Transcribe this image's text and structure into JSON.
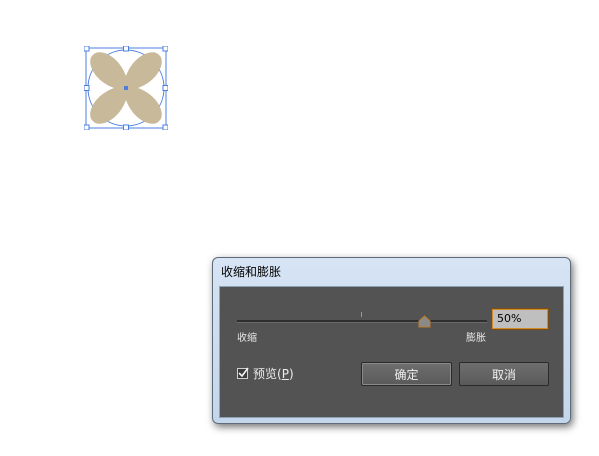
{
  "dialog": {
    "title": "收缩和膨胀",
    "slider": {
      "left_label": "收缩",
      "right_label": "膨胀",
      "value_percent": 50
    },
    "amount_field_value": "50%",
    "preview": {
      "label_prefix": "预览(",
      "label_key": "P",
      "label_suffix": ")",
      "checked": true
    },
    "ok_label": "确定",
    "cancel_label": "取消"
  },
  "colors": {
    "shape_fill": "#c8b99a",
    "selection_blue": "#4a7fe0",
    "dialog_body": "#535353",
    "focus_orange": "#d08a2a"
  }
}
